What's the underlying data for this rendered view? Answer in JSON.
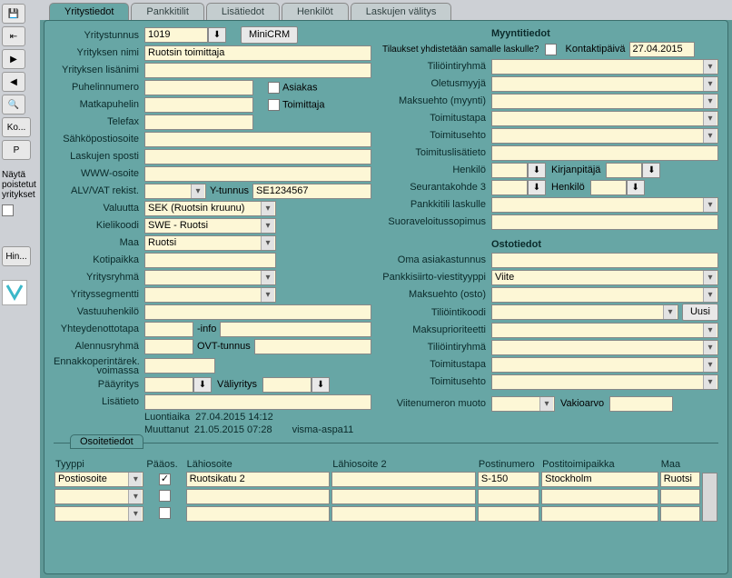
{
  "tabs": [
    "Yritystiedot",
    "Pankkitilit",
    "Lisätiedot",
    "Henkilöt",
    "Laskujen välitys"
  ],
  "toolbar": {
    "ko_label": "Ko...",
    "p_label": "P",
    "hin_label": "Hin...",
    "side_label": "Näytä\npoistetut\nyritykset"
  },
  "left": {
    "yritystunnus": "Yritystunnus",
    "yritystunnus_val": "1019",
    "minicrm": "MiniCRM",
    "yrityksen_nimi": "Yrityksen nimi",
    "yrityksen_nimi_val": "Ruotsin toimittaja",
    "yrityksen_lisanimi": "Yrityksen lisänimi",
    "puhelinnumero": "Puhelinnumero",
    "matkapuhelin": "Matkapuhelin",
    "telefax": "Telefax",
    "sahkopostiosoite": "Sähköpostiosoite",
    "laskujen_sposti": "Laskujen sposti",
    "www": "WWW-osoite",
    "alv": "ALV/VAT rekist.",
    "ytunnus": "Y-tunnus",
    "ytunnus_val": "SE1234567",
    "valuutta": "Valuutta",
    "valuutta_val": "SEK (Ruotsin kruunu)",
    "kielikoodi": "Kielikoodi",
    "kielikoodi_val": "SWE - Ruotsi",
    "maa": "Maa",
    "maa_val": "Ruotsi",
    "kotipaikka": "Kotipaikka",
    "yritysryhma": "Yritysryhmä",
    "yrityssegmentti": "Yrityssegmentti",
    "vastuuhenkilo": "Vastuuhenkilö",
    "yhteydenottotapa": "Yhteydenottotapa",
    "info": "-info",
    "alennusryhma": "Alennusryhmä",
    "ovt": "OVT-tunnus",
    "ennakko": "Ennakkoperintärek.\nvoimassa",
    "paayritys": "Pääyritys",
    "valiyritys": "Väliyritys",
    "lisatieto": "Lisätieto",
    "asiakas": "Asiakas",
    "toimittaja": "Toimittaja"
  },
  "right": {
    "myyntitiedot": "Myyntitiedot",
    "tilaukset": "Tilaukset yhdistetään samalle laskulle?",
    "kontaktipaiva": "Kontaktipäivä",
    "kontaktipaiva_val": "27.04.2015",
    "tiliointiryhma": "Tiliöintiryhmä",
    "oletusmyyja": "Oletusmyyjä",
    "maksuehto_m": "Maksuehto (myynti)",
    "toimitustapa": "Toimitustapa",
    "toimitusehto": "Toimitusehto",
    "toimituslisa": "Toimituslisätieto",
    "henkilo": "Henkilö",
    "kirjanpitaja": "Kirjanpitäjä",
    "seurantakohde": "Seurantakohde 3",
    "henkilo2": "Henkilö",
    "pankkitili": "Pankkitili laskulle",
    "suoraveloitus": "Suoraveloitussopimus",
    "ostotiedot": "Ostotiedot",
    "oma_asiakas": "Oma asiakastunnus",
    "pankkisiirto": "Pankkisiirto-viestityyppi",
    "pankkisiirto_val": "Viite",
    "maksuehto_o": "Maksuehto (osto)",
    "tiliointikoodi": "Tiliöintikoodi",
    "uusi": "Uusi",
    "maksuprio": "Maksuprioriteetti",
    "tiliointiryhma2": "Tiliöintiryhmä",
    "toimitustapa2": "Toimitustapa",
    "toimitusehto2": "Toimitusehto",
    "viitenumeron": "Viitenumeron muoto",
    "vakioarvo": "Vakioarvo"
  },
  "footer": {
    "luontiaika": "Luontiaika",
    "luontiaika_val": "27.04.2015 14:12",
    "muuttanut": "Muuttanut",
    "muuttanut_val": "21.05.2015 07:28",
    "user": "visma-aspa11"
  },
  "addr": {
    "title": "Osoitetiedot",
    "cols": [
      "Tyyppi",
      "Pääos.",
      "Lähiosoite",
      "Lähiosoite 2",
      "Postinumero",
      "Postitoimipaikka",
      "Maa"
    ],
    "rows": [
      {
        "tyyppi": "Postiosoite",
        "paa": true,
        "katu": "Ruotsikatu 2",
        "katu2": "",
        "postinro": "S-150",
        "ptp": "Stockholm",
        "maa": "Ruotsi"
      },
      {
        "tyyppi": "",
        "paa": false,
        "katu": "",
        "katu2": "",
        "postinro": "",
        "ptp": "",
        "maa": ""
      },
      {
        "tyyppi": "",
        "paa": false,
        "katu": "",
        "katu2": "",
        "postinro": "",
        "ptp": "",
        "maa": ""
      }
    ]
  }
}
